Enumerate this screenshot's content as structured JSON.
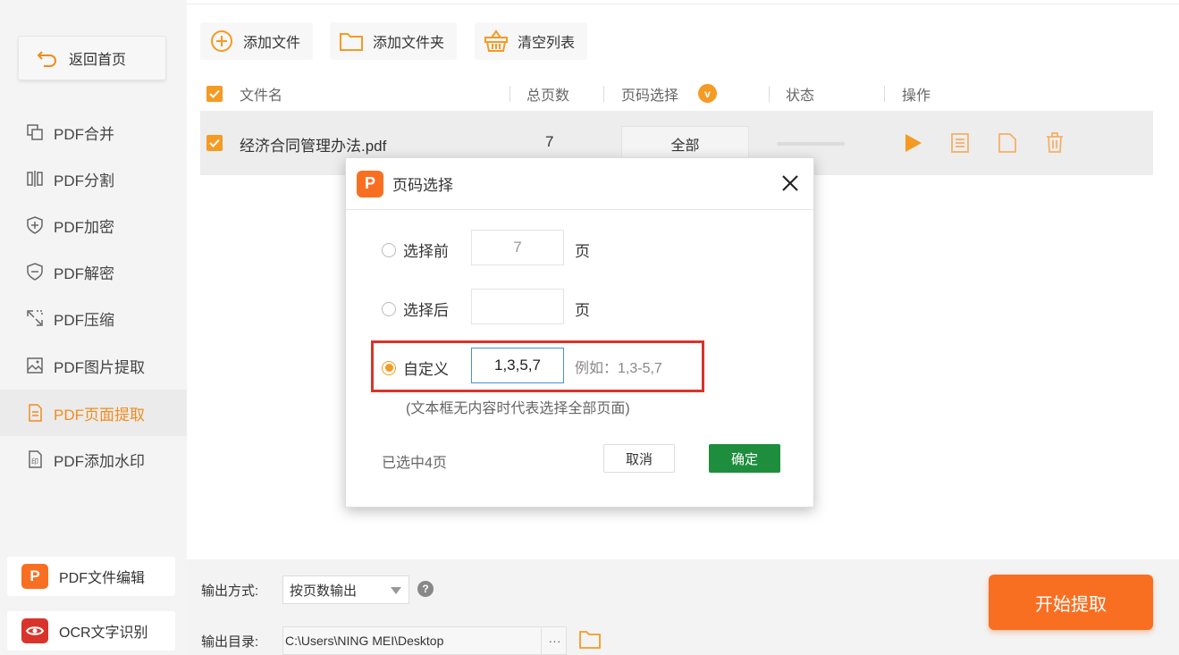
{
  "sidebar": {
    "back_label": "返回首页",
    "items": [
      {
        "label": "PDF合并",
        "icon": "merge-icon"
      },
      {
        "label": "PDF分割",
        "icon": "split-icon"
      },
      {
        "label": "PDF加密",
        "icon": "shield-plus-icon"
      },
      {
        "label": "PDF解密",
        "icon": "shield-minus-icon"
      },
      {
        "label": "PDF压缩",
        "icon": "compress-icon"
      },
      {
        "label": "PDF图片提取",
        "icon": "image-icon"
      },
      {
        "label": "PDF页面提取",
        "icon": "page-extract-icon",
        "active": true
      },
      {
        "label": "PDF添加水印",
        "icon": "watermark-icon"
      }
    ],
    "bottom_apps": [
      {
        "label": "PDF文件编辑",
        "logo": "P",
        "color": "#f96f22"
      },
      {
        "label": "OCR文字识别",
        "logo": "eye",
        "color": "#d9342b"
      }
    ]
  },
  "toolbar": {
    "add_file": "添加文件",
    "add_folder": "添加文件夹",
    "clear_list": "清空列表"
  },
  "table": {
    "headers": {
      "filename": "文件名",
      "total_pages": "总页数",
      "page_select": "页码选择",
      "page_select_badge": "v",
      "status": "状态",
      "actions": "操作"
    },
    "rows": [
      {
        "filename": "经济合同管理办法.pdf",
        "total_pages": "7",
        "page_select": "全部",
        "checked": true
      }
    ]
  },
  "output": {
    "mode_label": "输出方式:",
    "mode_value": "按页数输出",
    "dir_label": "输出目录:",
    "dir_value": "C:\\Users\\NING MEI\\Desktop",
    "dots": "···",
    "start_label": "开始提取"
  },
  "dialog": {
    "title": "页码选择",
    "options": {
      "first_label": "选择前",
      "first_value": "7",
      "last_label": "选择后",
      "last_value": "",
      "custom_label": "自定义",
      "custom_value": "1,3,5,7",
      "unit": "页"
    },
    "example": "例如：1,3-5,7",
    "hint": "(文本框无内容时代表选择全部页面)",
    "selected_count": "已选中4页",
    "cancel_label": "取消",
    "ok_label": "确定"
  },
  "colors": {
    "accent": "#f59a23",
    "start_button": "#f96f22",
    "ok_button": "#1e8e3e",
    "highlight": "#d9342b"
  }
}
